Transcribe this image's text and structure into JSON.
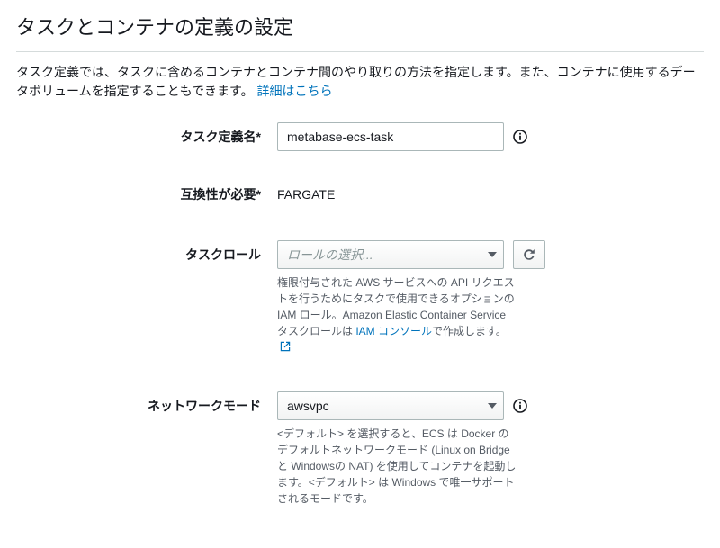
{
  "header": {
    "title": "タスクとコンテナの定義の設定",
    "description_prefix": "タスク定義では、タスクに含めるコンテナとコンテナ間のやり取りの方法を指定します。また、コンテナに使用するデータボリュームを指定することもできます。",
    "learn_more_label": "詳細はこちら"
  },
  "form": {
    "task_definition_name": {
      "label": "タスク定義名*",
      "value": "metabase-ecs-task"
    },
    "compatibility": {
      "label": "互換性が必要*",
      "value": "FARGATE"
    },
    "task_role": {
      "label": "タスクロール",
      "placeholder": "ロールの選択...",
      "help_prefix": "権限付与された AWS サービスへの API リクエストを行うためにタスクで使用できるオプションの IAM ロール。Amazon Elastic Container Service タスクロールは ",
      "help_link": "IAM コンソール",
      "help_suffix": "で作成します。"
    },
    "network_mode": {
      "label": "ネットワークモード",
      "value": "awsvpc",
      "help": "<デフォルト> を選択すると、ECS は Docker のデフォルトネットワークモード (Linux on Bridge と Windowsの NAT) を使用してコンテナを起動します。<デフォルト> は Windows で唯一サポートされるモードです。"
    }
  }
}
